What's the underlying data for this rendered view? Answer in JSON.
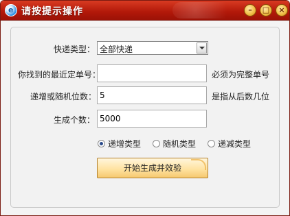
{
  "window": {
    "title": "请按提示操作",
    "app_icon_letter": "e"
  },
  "titlebar_buttons": {
    "minimize": "–",
    "maximize": "□",
    "close": "×"
  },
  "form": {
    "type_label": "快递类型：",
    "type_value": "全部快递",
    "nearest_label": "你找到的最近定单号：",
    "nearest_value": "",
    "nearest_hint": "必须为完整单号",
    "digits_label": "递增或随机位数：",
    "digits_value": "5",
    "digits_hint": "是指从后数几位",
    "count_label": "生成个数：",
    "count_value": "5000"
  },
  "radios": [
    {
      "label": "递增类型",
      "selected": true
    },
    {
      "label": "随机类型",
      "selected": false
    },
    {
      "label": "递减类型",
      "selected": false
    }
  ],
  "action_button": "开始生成并效验"
}
